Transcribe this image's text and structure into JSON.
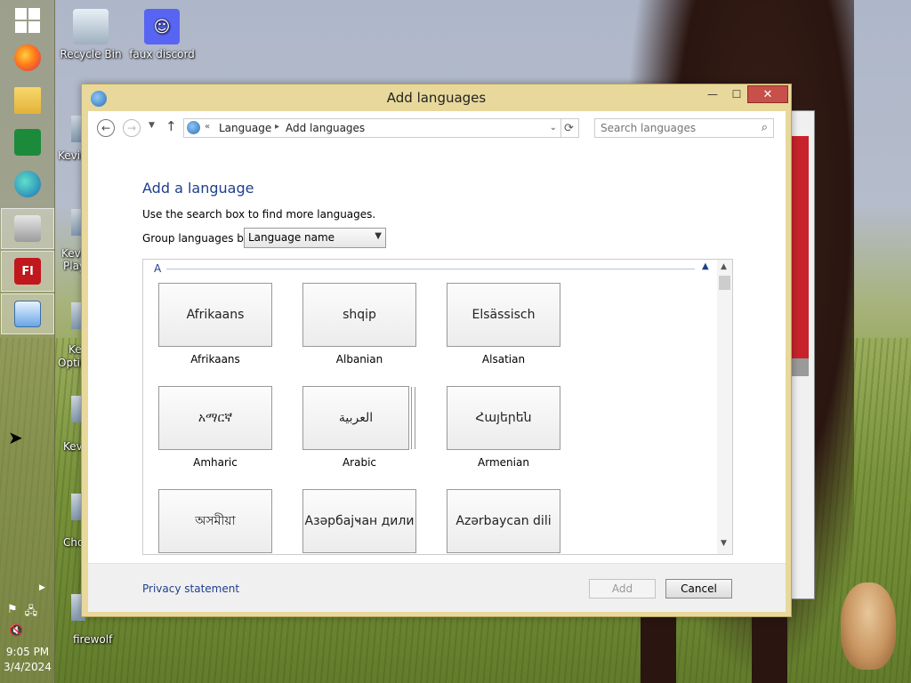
{
  "desktop": {
    "icons": [
      {
        "label": "Recycle Bin"
      },
      {
        "label": "faux discord"
      }
    ],
    "partial_labels": [
      "Kevir",
      "Kevi",
      "Play",
      "Ke",
      "Optin",
      "Kevi",
      "Cho",
      "firewolf"
    ]
  },
  "taskbar": {
    "clock_time": "9:05 PM",
    "clock_date": "3/4/2024"
  },
  "window": {
    "title": "Add languages",
    "minimize": "—",
    "maximize": "☐",
    "close": "✕"
  },
  "address": {
    "prefix": "«",
    "crumbs": [
      "Language",
      "Add languages"
    ],
    "search_placeholder": "Search languages"
  },
  "content": {
    "heading": "Add a language",
    "hint": "Use the search box to find more languages.",
    "group_label": "Group languages by:",
    "group_value": "Language name",
    "section_letter": "A",
    "languages": [
      {
        "native": "Afrikaans",
        "name": "Afrikaans"
      },
      {
        "native": "shqip",
        "name": "Albanian"
      },
      {
        "native": "Elsässisch",
        "name": "Alsatian"
      },
      {
        "native": "አማርኛ",
        "name": "Amharic"
      },
      {
        "native": "العربية",
        "name": "Arabic"
      },
      {
        "native": "Հայերեն",
        "name": "Armenian"
      },
      {
        "native": "অসমীয়া",
        "name": ""
      },
      {
        "native": "Азәрбајҹан дили",
        "name": ""
      },
      {
        "native": "Azərbaycan dili",
        "name": ""
      }
    ]
  },
  "footer": {
    "privacy": "Privacy statement",
    "add": "Add",
    "cancel": "Cancel"
  }
}
